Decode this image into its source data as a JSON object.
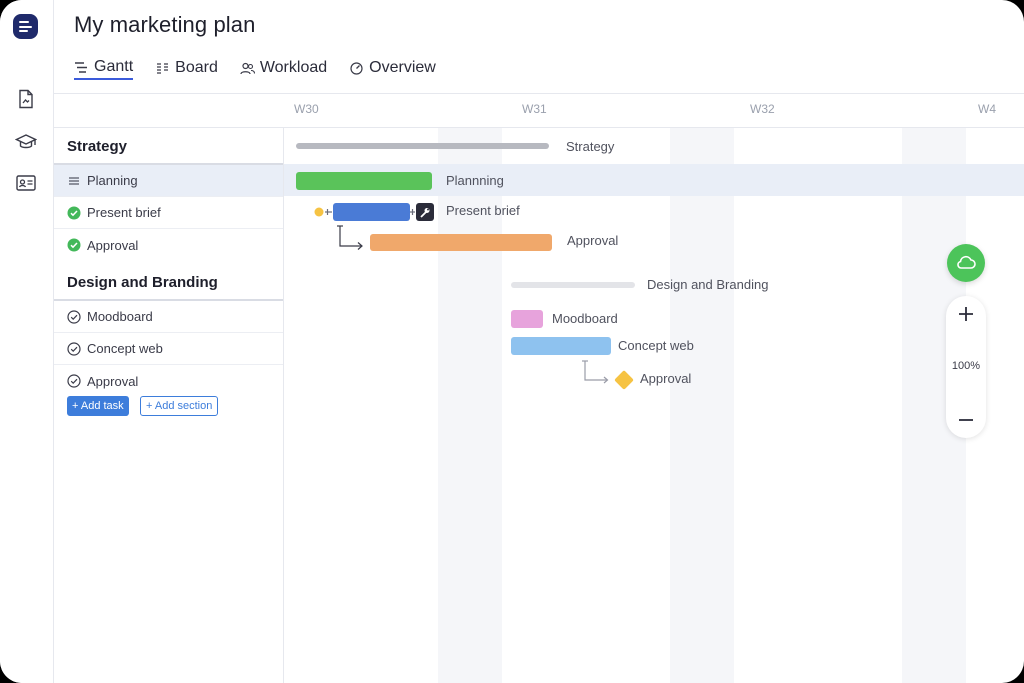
{
  "title": "My marketing plan",
  "tabs": [
    {
      "label": "Gantt",
      "icon": "gantt-icon",
      "active": true
    },
    {
      "label": "Board",
      "icon": "board-icon",
      "active": false
    },
    {
      "label": "Workload",
      "icon": "workload-icon",
      "active": false
    },
    {
      "label": "Overview",
      "icon": "overview-icon",
      "active": false
    }
  ],
  "weeks": [
    "W30",
    "W31",
    "W32",
    "W4"
  ],
  "sections": [
    {
      "title": "Strategy",
      "tasks": [
        {
          "label": "Planning",
          "icon": "drag-handle-icon",
          "selected": true
        },
        {
          "label": "Present brief",
          "icon": "check-filled-icon"
        },
        {
          "label": "Approval",
          "icon": "check-filled-icon"
        }
      ]
    },
    {
      "title": "Design and Branding",
      "tasks": [
        {
          "label": "Moodboard",
          "icon": "check-outline-icon"
        },
        {
          "label": "Concept web",
          "icon": "check-outline-icon"
        },
        {
          "label": "Approval",
          "icon": "check-outline-icon"
        }
      ]
    }
  ],
  "buttons": {
    "add_task": "+ Add task",
    "add_section": "+ Add section"
  },
  "gantt_labels": {
    "strategy": "Strategy",
    "planning": "Plannning",
    "present_brief": "Present brief",
    "approval_1": "Approval",
    "design_branding": "Design and Branding",
    "moodboard": "Moodboard",
    "concept_web": "Concept web",
    "approval_2": "Approval"
  },
  "colors": {
    "planning": "#5ac35a",
    "present_brief": "#4a7bd6",
    "approval": "#f0a86b",
    "moodboard": "#e7a3dc",
    "concept_web": "#8ec2ef",
    "milestone": "#f6c343",
    "accent": "#3b5bdb",
    "cloud": "#4cc45a"
  },
  "zoom": {
    "level": "100%"
  }
}
